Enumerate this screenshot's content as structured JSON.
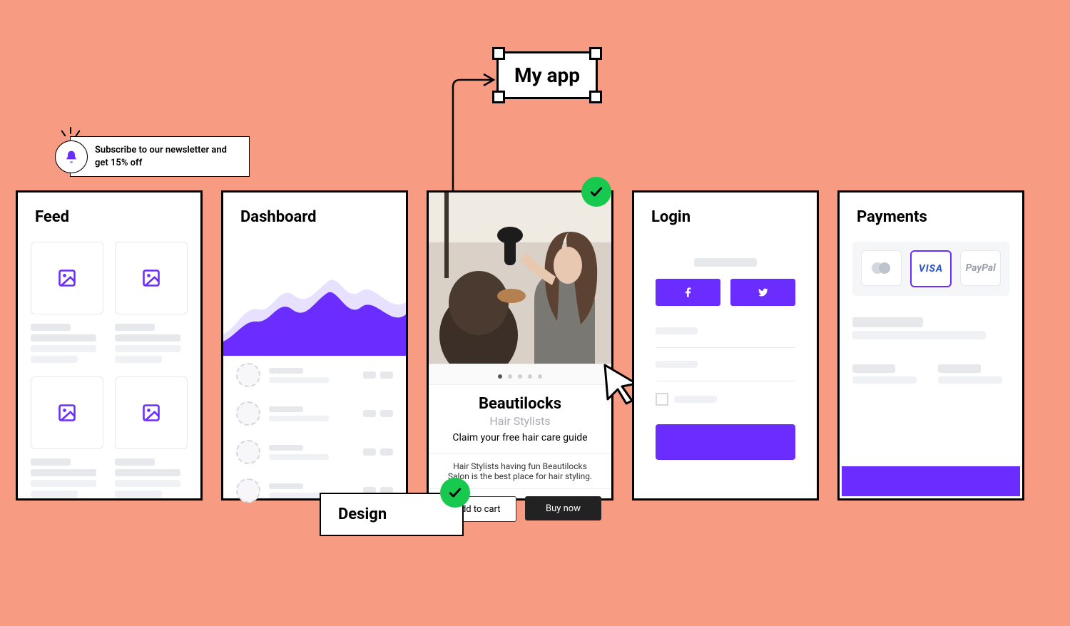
{
  "selection": {
    "label": "My app"
  },
  "notification": {
    "text": "Subscribe to our newsletter and get 15% off",
    "icon": "bell-icon"
  },
  "screens": {
    "feed": {
      "title": "Feed"
    },
    "dashboard": {
      "title": "Dashboard"
    },
    "login": {
      "title": "Login",
      "social": [
        "facebook-icon",
        "twitter-icon"
      ]
    },
    "payments": {
      "title": "Payments",
      "methods": [
        {
          "label": "",
          "icon": "mastercard-icon",
          "selected": false
        },
        {
          "label": "VISA",
          "icon": "visa-icon",
          "selected": true
        },
        {
          "label": "PayPal",
          "icon": "paypal-icon",
          "selected": false
        }
      ]
    },
    "product": {
      "title": "Beautilocks",
      "subtitle": "Hair Stylists",
      "tagline": "Claim your free hair care guide",
      "description": "Hair Stylists having fun Beautilocks Salon is the best place for hair styling.",
      "add_to_cart": "Add to cart",
      "buy_now": "Buy now",
      "dots_count": 5,
      "active_dot": 0
    }
  },
  "design_label": "Design",
  "colors": {
    "accent": "#6a2cff",
    "success": "#18c950",
    "canvas": "#f79b82"
  }
}
